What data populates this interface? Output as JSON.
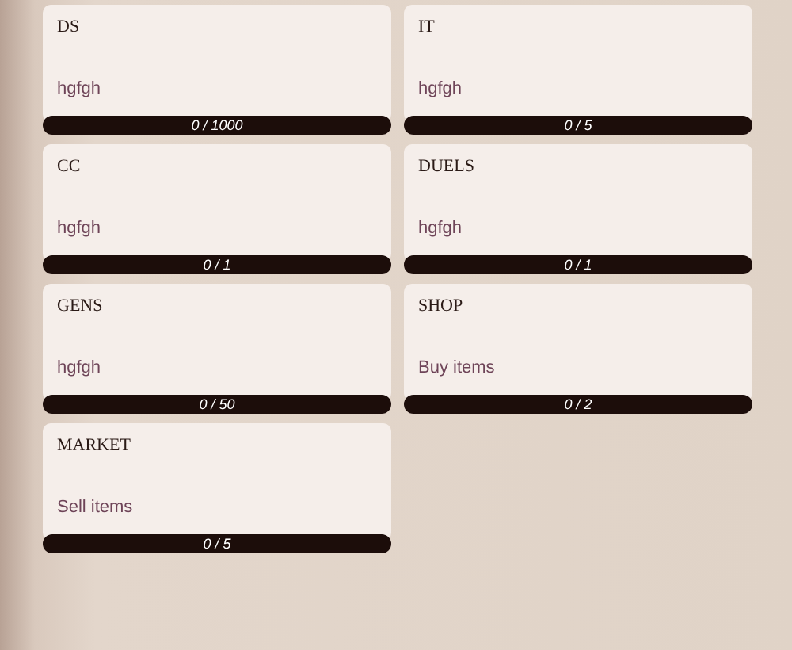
{
  "cards": [
    {
      "title": "DS",
      "description": "hgfgh",
      "progress": "0 / 1000"
    },
    {
      "title": "IT",
      "description": "hgfgh",
      "progress": "0 / 5"
    },
    {
      "title": "CC",
      "description": "hgfgh",
      "progress": "0 / 1"
    },
    {
      "title": "DUELS",
      "description": "hgfgh",
      "progress": "0 / 1"
    },
    {
      "title": "GENS",
      "description": "hgfgh",
      "progress": "0 / 50"
    },
    {
      "title": "SHOP",
      "description": "Buy items",
      "progress": "0 / 2"
    },
    {
      "title": "MARKET",
      "description": "Sell items",
      "progress": "0 / 5"
    }
  ]
}
